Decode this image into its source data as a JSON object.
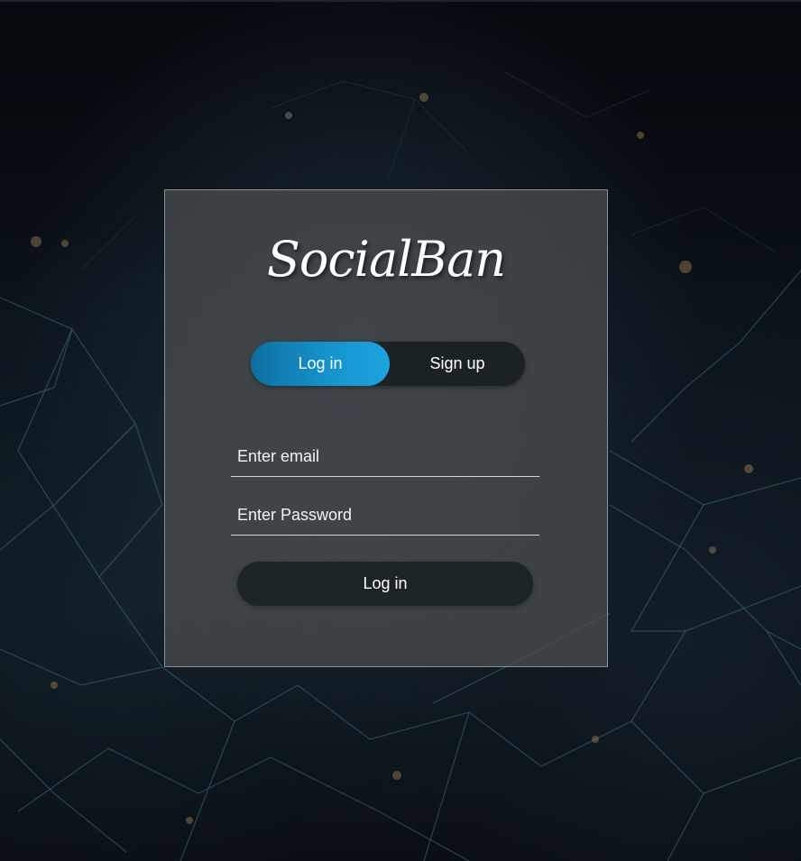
{
  "brand": {
    "logo_text": "SocialBan"
  },
  "auth_toggle": {
    "login_label": "Log in",
    "signup_label": "Sign up",
    "active": "login"
  },
  "form": {
    "email_placeholder": "Enter email",
    "password_placeholder": "Enter Password",
    "submit_label": "Log in"
  },
  "colors": {
    "accent": "#1593cc",
    "card_background": "#4e5052",
    "button_dark": "#1d2426"
  }
}
